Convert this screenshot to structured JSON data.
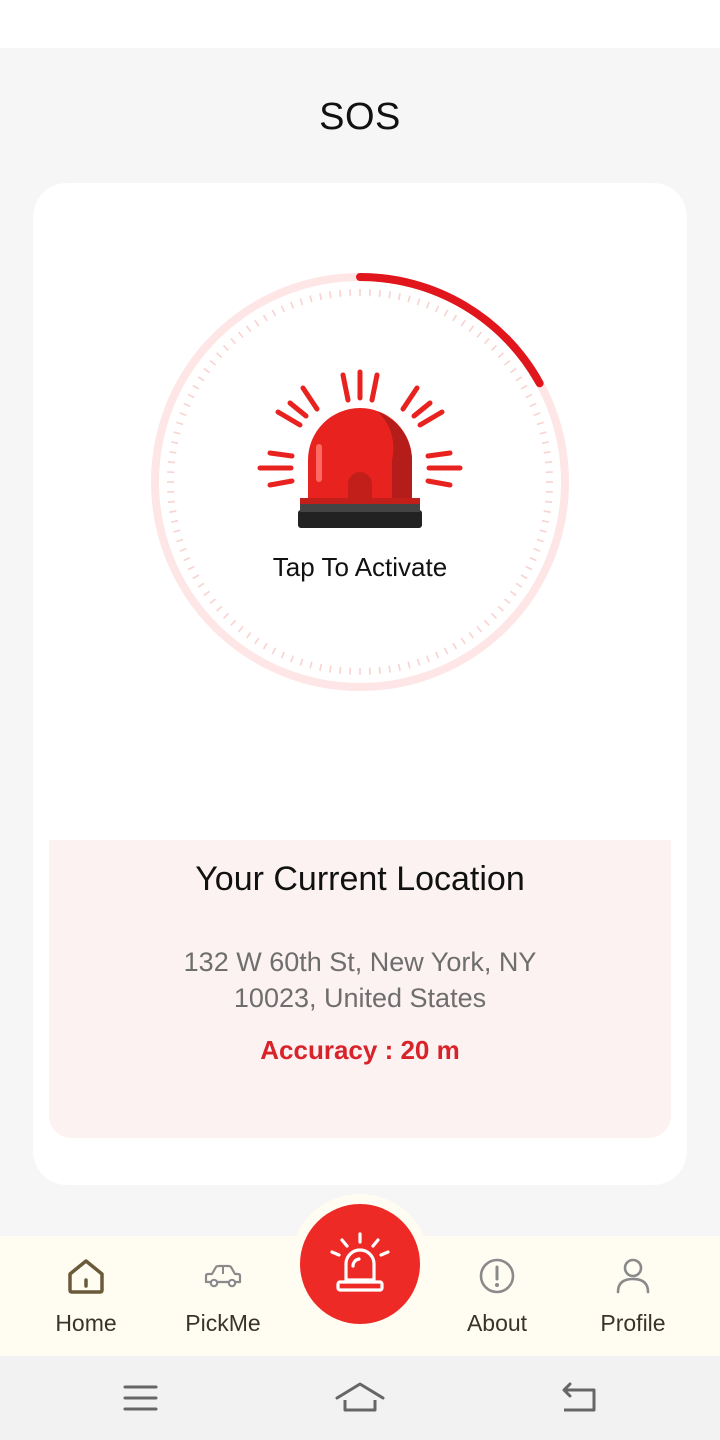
{
  "header": {
    "title": "SOS"
  },
  "sos": {
    "activate_label": "Tap To Activate",
    "progress": 0.17,
    "colors": {
      "accent": "#ee2a26",
      "ring_track": "#fde6e5",
      "progress_arc": "#e0161c"
    }
  },
  "location": {
    "title": "Your Current Location",
    "address_line1": "132 W 60th St, New York, NY",
    "address_line2": "10023, United States",
    "accuracy": "Accuracy : 20 m"
  },
  "bottom_nav": {
    "items": [
      {
        "label": "Home",
        "icon": "home-icon"
      },
      {
        "label": "PickMe",
        "icon": "car-icon"
      },
      {
        "label": "About",
        "icon": "info-icon"
      },
      {
        "label": "Profile",
        "icon": "user-icon"
      }
    ],
    "center": {
      "icon": "siren-icon"
    }
  },
  "system_nav": {
    "icons": [
      "menu-icon",
      "home-icon",
      "back-icon"
    ]
  }
}
